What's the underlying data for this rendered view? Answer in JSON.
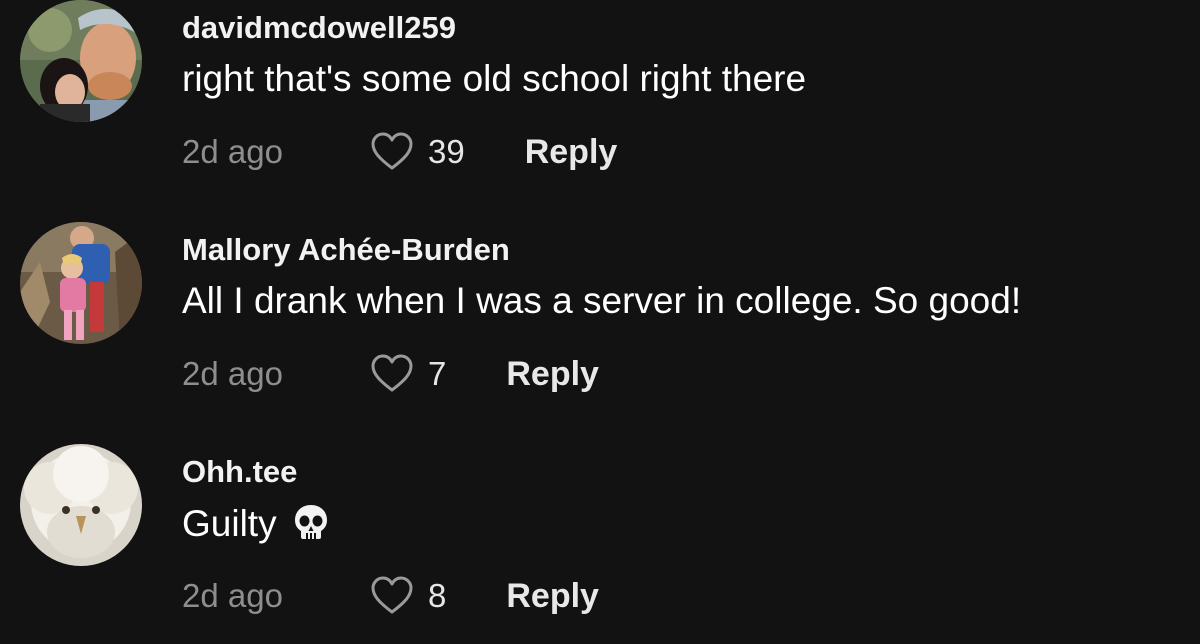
{
  "comments": [
    {
      "username": "davidmcdowell259",
      "text": "right that's some old school right there",
      "time": "2d ago",
      "likes": "39",
      "reply_label": "Reply"
    },
    {
      "username": "Mallory Achée-Burden",
      "text": "All I drank when I was a server in college. So good!",
      "time": "2d ago",
      "likes": "7",
      "reply_label": "Reply"
    },
    {
      "username": "Ohh.tee",
      "text": "Guilty",
      "emoji": "skull-emoji",
      "time": "2d ago",
      "likes": "8",
      "reply_label": "Reply"
    }
  ],
  "icons": {
    "like": "heart-outline-icon"
  },
  "colors": {
    "background": "#121212",
    "username": "#f2f2f2",
    "text": "#ffffff",
    "meta": "#8e8e8e"
  }
}
